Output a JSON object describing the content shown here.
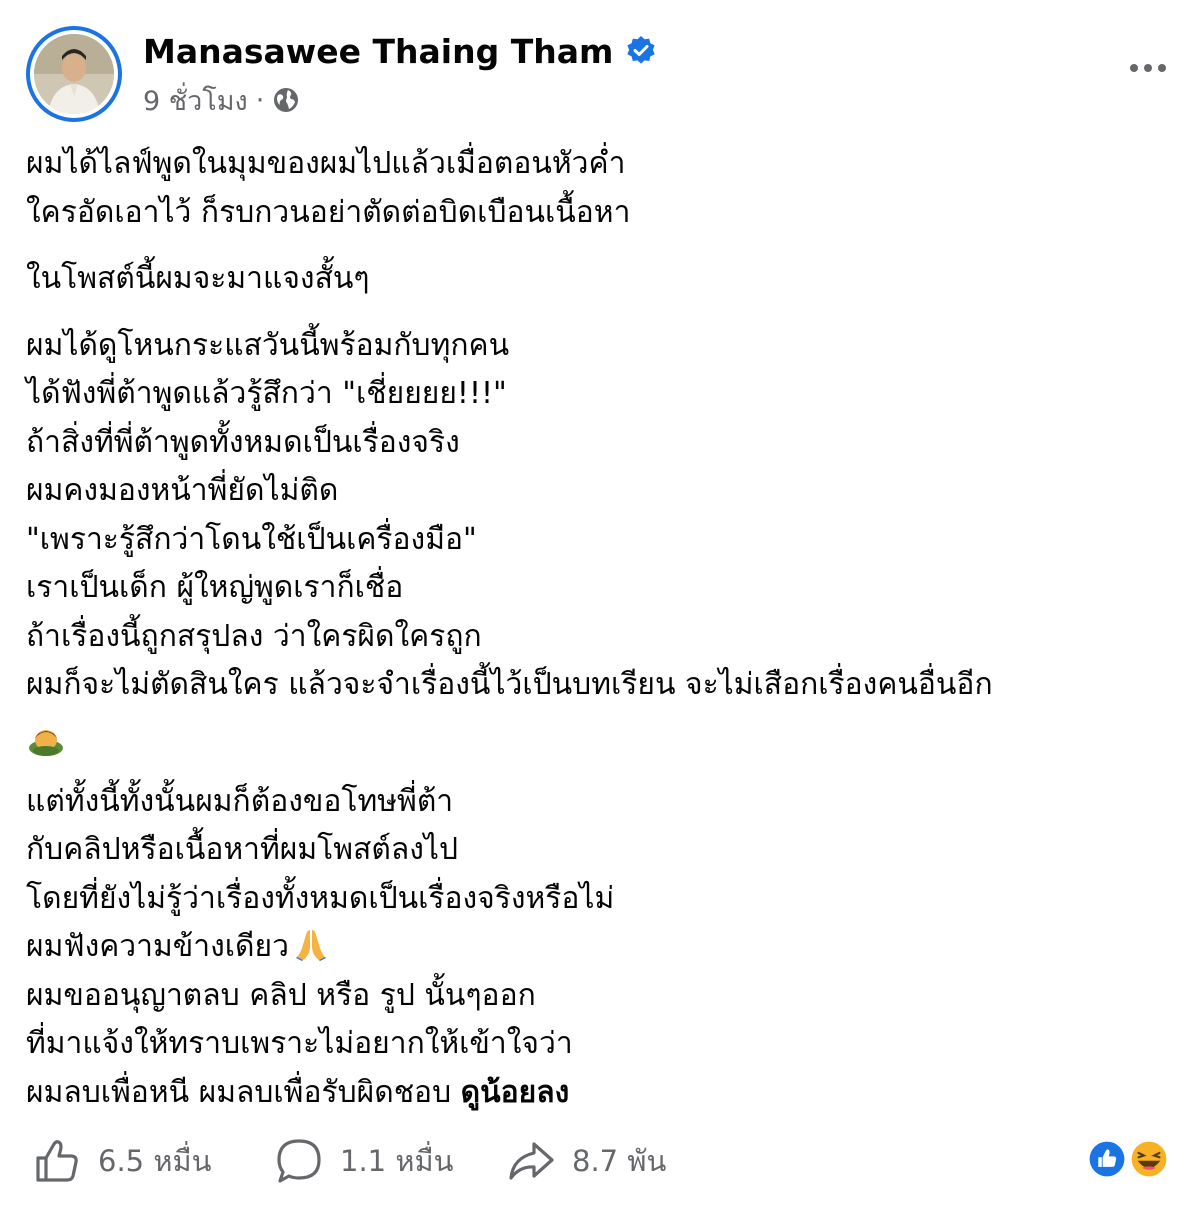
{
  "author": {
    "name": "Manasawee Thaing Tham",
    "verified_icon": "verified-badge-icon",
    "time": "9 ชั่วโมง",
    "separator": "·",
    "privacy_icon": "globe-icon"
  },
  "header": {
    "more_icon": "more-options-icon"
  },
  "post": {
    "p1": [
      "ผมได้ไลฟ์พูดในมุมของผมไปแล้วเมื่อตอนหัวค่ำ",
      "ใครอัดเอาไว้ ก็รบกวนอย่าตัดต่อบิดเบือนเนื้อหา"
    ],
    "p2": [
      "ในโพสต์นี้ผมจะมาแจงสั้นๆ"
    ],
    "p3": [
      "ผมได้ดูโหนกระแสวันนี้พร้อมกับทุกคน",
      "ได้ฟังพี่ต้าพูดแล้วรู้สึกว่า \"เชี่ยยยย!!!\"",
      "ถ้าสิ่งที่พี่ต้าพูดทั้งหมดเป็นเรื่องจริง",
      "ผมคงมองหน้าพี่ยัดไม่ติด",
      "\"เพราะรู้สึกว่าโดนใช้เป็นเครื่องมือ\"",
      "เราเป็นเด็ก ผู้ใหญ่พูดเราก็เชื่อ",
      "ถ้าเรื่องนี้ถูกสรุปลง ว่าใครผิดใครถูก",
      "ผมก็จะไม่ตัดสินใคร  แล้วจะจำเรื่องนี้ไว้เป็นบทเรียน จะไม่เสือกเรื่องคนอื่นอีก"
    ],
    "p3_emoji": "bowing-person-emoji",
    "p4": [
      "แต่ทั้งนี้ทั้งนั้นผมก็ต้องขอโทษพี่ต้า",
      "กับคลิปหรือเนื้อหาที่ผมโพสต์ลงไป",
      "โดยที่ยังไม่รู้ว่าเรื่องทั้งหมดเป็นเรื่องจริงหรือไม่",
      "ผมฟังความข้างเดียว"
    ],
    "p4_emoji": "folded-hands-emoji",
    "p5": [
      "ผมขออนุญาตลบ คลิป หรือ รูป นั้นๆออก",
      "ที่มาแจ้งให้ทราบเพราะไม่อยากให้เข้าใจว่า",
      "ผมลบเพื่อหนี  ผมลบเพื่อรับผิดชอบ"
    ],
    "see_more": "ดูน้อยลง"
  },
  "footer": {
    "likes": "6.5 หมื่น",
    "comments": "1.1 หมื่น",
    "shares": "8.7 พัน",
    "like_icon": "thumbs-up-icon",
    "comment_icon": "comment-bubble-icon",
    "share_icon": "share-arrow-icon",
    "reaction_icons": [
      "like-reaction-icon",
      "haha-reaction-icon"
    ]
  },
  "colors": {
    "accent": "#1b74e4",
    "text": "#050505",
    "secondary": "#65676b"
  }
}
